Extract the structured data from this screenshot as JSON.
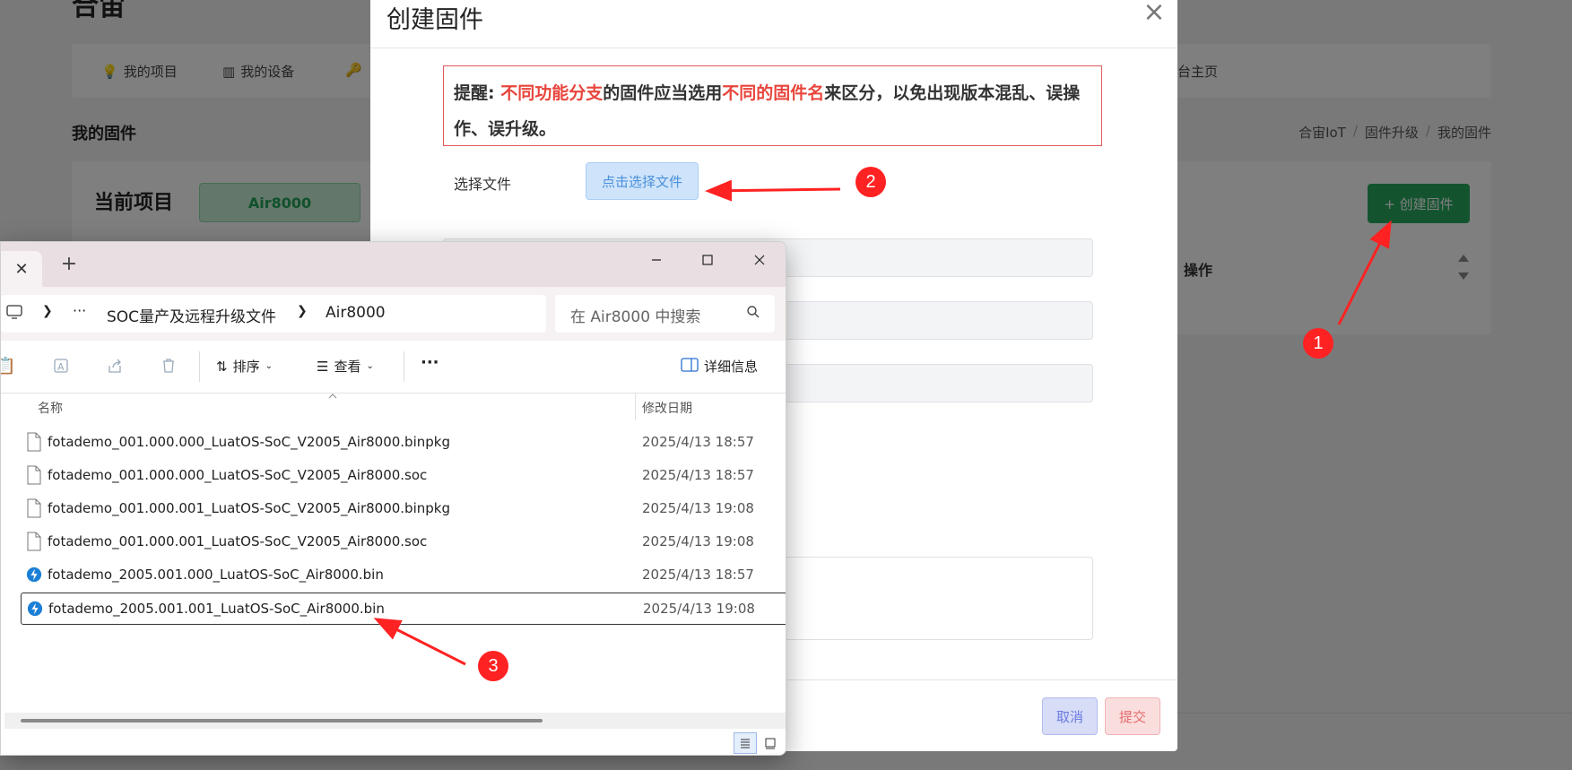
{
  "background": {
    "heading": "合宙",
    "nav": [
      {
        "label": "我的项目",
        "icon": "lightbulb-icon"
      },
      {
        "label": "我的设备",
        "icon": "chip-icon"
      },
      {
        "label": "",
        "icon": "key-icon"
      },
      {
        "label": "台主页",
        "icon": ""
      }
    ],
    "section_title": "我的固件",
    "breadcrumb": [
      "合宙IoT",
      "固件升级",
      "我的固件"
    ],
    "current_project_label": "当前项目",
    "current_project_value": "Air8000",
    "create_button": "+ 创建固件",
    "column_operation": "操作"
  },
  "modal": {
    "title": "创建固件",
    "alert": {
      "prefix": "提醒: ",
      "hl1": "不同功能分支",
      "mid": "的固件应当选用",
      "hl2": "不同的固件名",
      "suffix": "来区分，以免出现版本混乱、误操作、误升级。"
    },
    "file_label": "选择文件",
    "pick_button": "点击选择文件",
    "cancel_button": "取消",
    "submit_button": "提交"
  },
  "explorer": {
    "path": [
      "SOC量产及远程升级文件",
      "Air8000"
    ],
    "search_placeholder": "在 Air8000 中搜索",
    "toolbar": {
      "sort": "排序",
      "view": "查看",
      "more": "···",
      "details": "详细信息"
    },
    "columns": {
      "name": "名称",
      "date": "修改日期"
    },
    "files": [
      {
        "name": "fotademo_001.000.000_LuatOS-SoC_V2005_Air8000.binpkg",
        "date": "2025/4/13 18:57",
        "icon": "file-icon"
      },
      {
        "name": "fotademo_001.000.000_LuatOS-SoC_V2005_Air8000.soc",
        "date": "2025/4/13 18:57",
        "icon": "file-icon"
      },
      {
        "name": "fotademo_001.000.001_LuatOS-SoC_V2005_Air8000.binpkg",
        "date": "2025/4/13 19:08",
        "icon": "file-icon"
      },
      {
        "name": "fotademo_001.000.001_LuatOS-SoC_V2005_Air8000.soc",
        "date": "2025/4/13 19:08",
        "icon": "file-icon"
      },
      {
        "name": "fotademo_2005.001.000_LuatOS-SoC_Air8000.bin",
        "date": "2025/4/13 18:57",
        "icon": "bin-file-icon"
      },
      {
        "name": "fotademo_2005.001.001_LuatOS-SoC_Air8000.bin",
        "date": "2025/4/13 19:08",
        "icon": "bin-file-icon",
        "selected": true
      }
    ]
  },
  "annotations": {
    "markers": [
      "1",
      "2",
      "3"
    ],
    "color": "#ff2222"
  }
}
